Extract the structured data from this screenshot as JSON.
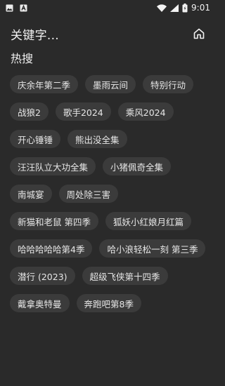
{
  "status_bar": {
    "time": "9:01",
    "left_icons": [
      "image-icon",
      "app-icon"
    ],
    "right_icons": [
      "wifi-icon",
      "signal-icon",
      "battery-icon"
    ]
  },
  "header": {
    "search_text": "关键字...",
    "home_icon": "home-icon"
  },
  "hot_search": {
    "title": "热搜",
    "rows": [
      [
        "庆余年第二季",
        "墨雨云间",
        "特别行动"
      ],
      [
        "战狼2",
        "歌手2024",
        "乘风2024"
      ],
      [
        "开心锤锤",
        "熊出没全集"
      ],
      [
        "汪汪队立大功全集",
        "小猪佩奇全集"
      ],
      [
        "南城宴",
        "周处除三害"
      ],
      [
        "新猫和老鼠 第四季",
        "狐妖小红娘月红篇"
      ],
      [
        "哈哈哈哈哈第4季",
        "哈小浪轻松一刻 第三季"
      ],
      [
        "潜行 (2023)",
        "超级飞侠第十四季"
      ],
      [
        "戴拿奥特曼",
        "奔跑吧第8季"
      ]
    ]
  }
}
